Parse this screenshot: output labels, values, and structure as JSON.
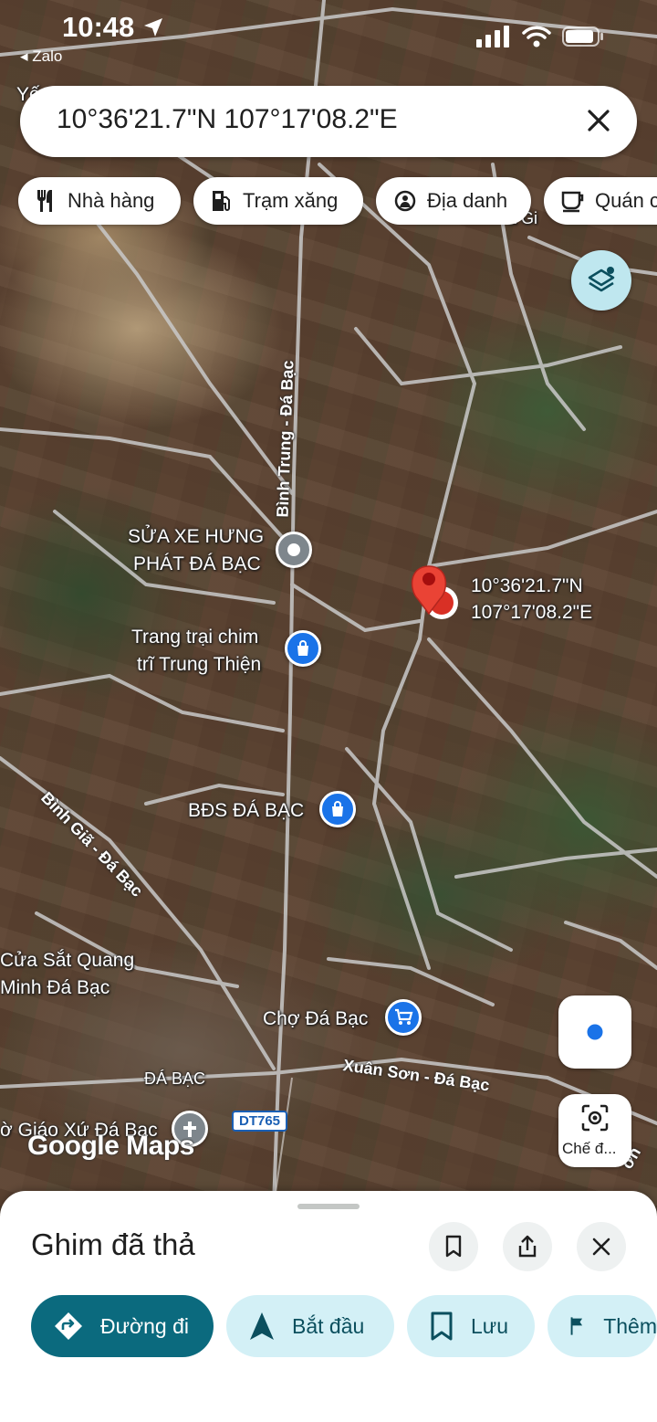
{
  "status_bar": {
    "time": "10:48",
    "back_app": "◂ Zalo"
  },
  "search": {
    "query": "10°36'21.7\"N 107°17'08.2\"E"
  },
  "chips": [
    {
      "label": "Nhà hàng",
      "icon": "restaurant-icon"
    },
    {
      "label": "Trạm xăng",
      "icon": "gas-station-icon"
    },
    {
      "label": "Địa danh",
      "icon": "landmark-icon"
    },
    {
      "label": "Quán c",
      "icon": "cafe-icon"
    }
  ],
  "map": {
    "pin_label_line1": "10°36'21.7\"N",
    "pin_label_line2": "107°17'08.2\"E",
    "places": {
      "sua_xe_1": "SỬA XE HƯNG",
      "sua_xe_2": "PHÁT ĐÁ BẠC",
      "trang_trai_1": "Trang trại chim",
      "trang_trai_2": "trĩ Trung Thiện",
      "bds": "BĐS ĐÁ BẠC",
      "cua_sat_1": "Cửa Sắt Quang",
      "cua_sat_2": "Minh Đá Bạc",
      "cho": "Chợ Đá Bạc",
      "giao_xu": "ờ Giáo Xứ Đá Bạc",
      "area": "ĐÁ BẠC",
      "top_left_fragment": "Yế",
      "top_right_fragment": "a Gi"
    },
    "roads": {
      "binh_trung": "Bình Trung - Đá Bạc",
      "binh_gia": "Bình Giã - Đá Bạc",
      "xuan_son": "Xuân Sơn - Đá Bạc",
      "dt765": "DT765",
      "edge_fragment": "ơn"
    },
    "watermark": "Google Maps",
    "live_view_label": "Chế đ..."
  },
  "sheet": {
    "title": "Ghim đã thả",
    "actions": [
      {
        "label": "Đường đi",
        "icon": "directions-icon"
      },
      {
        "label": "Bắt đầu",
        "icon": "navigation-arrow-icon"
      },
      {
        "label": "Lưu",
        "icon": "bookmark-icon"
      },
      {
        "label": "Thêm",
        "icon": "flag-icon"
      }
    ]
  },
  "colors": {
    "primary": "#0b6a7e",
    "secondary": "#d3f0f6",
    "pin": "#d93025",
    "poi_blue": "#1a73e8",
    "poi_gray": "#7e868c"
  }
}
